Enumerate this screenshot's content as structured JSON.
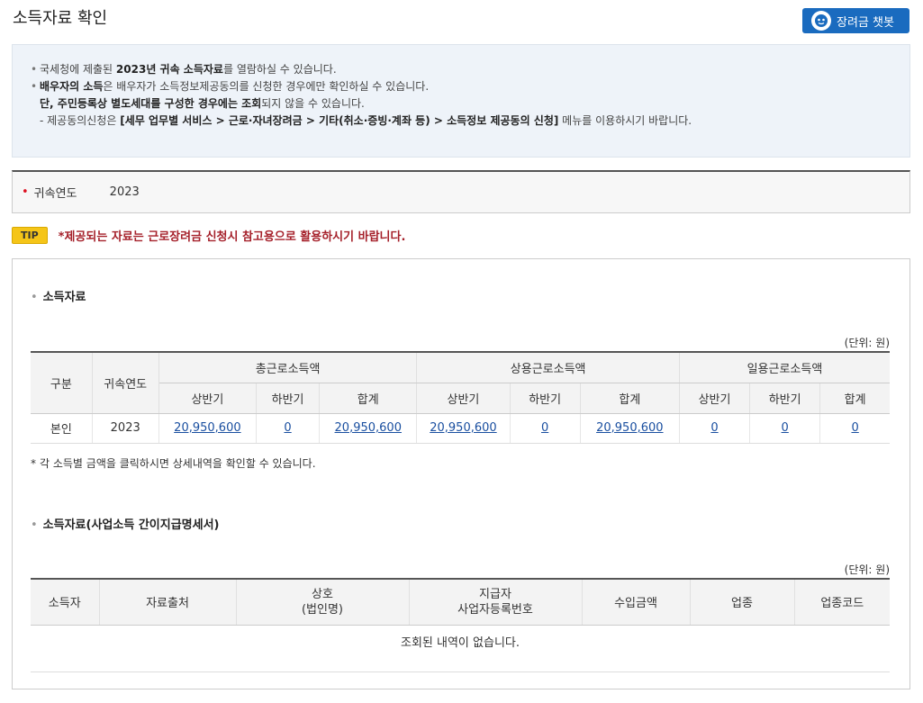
{
  "page": {
    "title": "소득자료 확인",
    "chatbot_label": "장려금 챗봇"
  },
  "notice": {
    "line1_pre": "국세청에 제출된 ",
    "line1_bold": "2023년 귀속 소득자료",
    "line1_post": "를 열람하실 수 있습니다.",
    "line2_bold": "배우자의 소득",
    "line2_post": "은 배우자가 소득정보제공동의를 신청한 경우에만 확인하실 수 있습니다.",
    "line3_bold": "단, 주민등록상 별도세대를 구성한 경우에는 조회",
    "line3_post": "되지 않을 수 있습니다.",
    "line4_pre": "- 제공동의신청은 ",
    "line4_bold": "[세무 업무별 서비스 > 근로·자녀장려금 > 기타(취소·증빙·계좌 등) > 소득정보 제공동의 신청]",
    "line4_post": " 메뉴를 이용하시기 바랍니다."
  },
  "year_filter": {
    "label": "귀속연도",
    "value": "2023"
  },
  "tip": {
    "badge": "TIP",
    "text": "*제공되는 자료는 근로장려금 신청시 참고용으로 활용하시기 바랍니다."
  },
  "income_section": {
    "title": "소득자료",
    "unit": "(단위: 원)",
    "headers": {
      "category": "구분",
      "year": "귀속연도",
      "total": "총근로소득액",
      "regular": "상용근로소득액",
      "daily": "일용근로소득액",
      "first_half": "상반기",
      "second_half": "하반기",
      "sum": "합계"
    },
    "rows": [
      {
        "category": "본인",
        "year": "2023",
        "total_first": "20,950,600",
        "total_second": "0",
        "total_sum": "20,950,600",
        "regular_first": "20,950,600",
        "regular_second": "0",
        "regular_sum": "20,950,600",
        "daily_first": "0",
        "daily_second": "0",
        "daily_sum": "0"
      }
    ],
    "note": "각 소득별 금액을 클릭하시면 상세내역을 확인할 수 있습니다."
  },
  "business_section": {
    "title": "소득자료(사업소득 간이지급명세서)",
    "unit": "(단위: 원)",
    "headers": {
      "earner": "소득자",
      "source": "자료출처",
      "company_line1": "상호",
      "company_line2": "(법인명)",
      "payer_line1": "지급자",
      "payer_line2": "사업자등록번호",
      "income": "수입금액",
      "industry": "업종",
      "industry_code": "업종코드"
    },
    "empty_message": "조회된 내역이 없습니다."
  },
  "colors": {
    "accent": "#1a6bbf",
    "tip_text": "#a5202a",
    "link": "#1a4fa0"
  }
}
